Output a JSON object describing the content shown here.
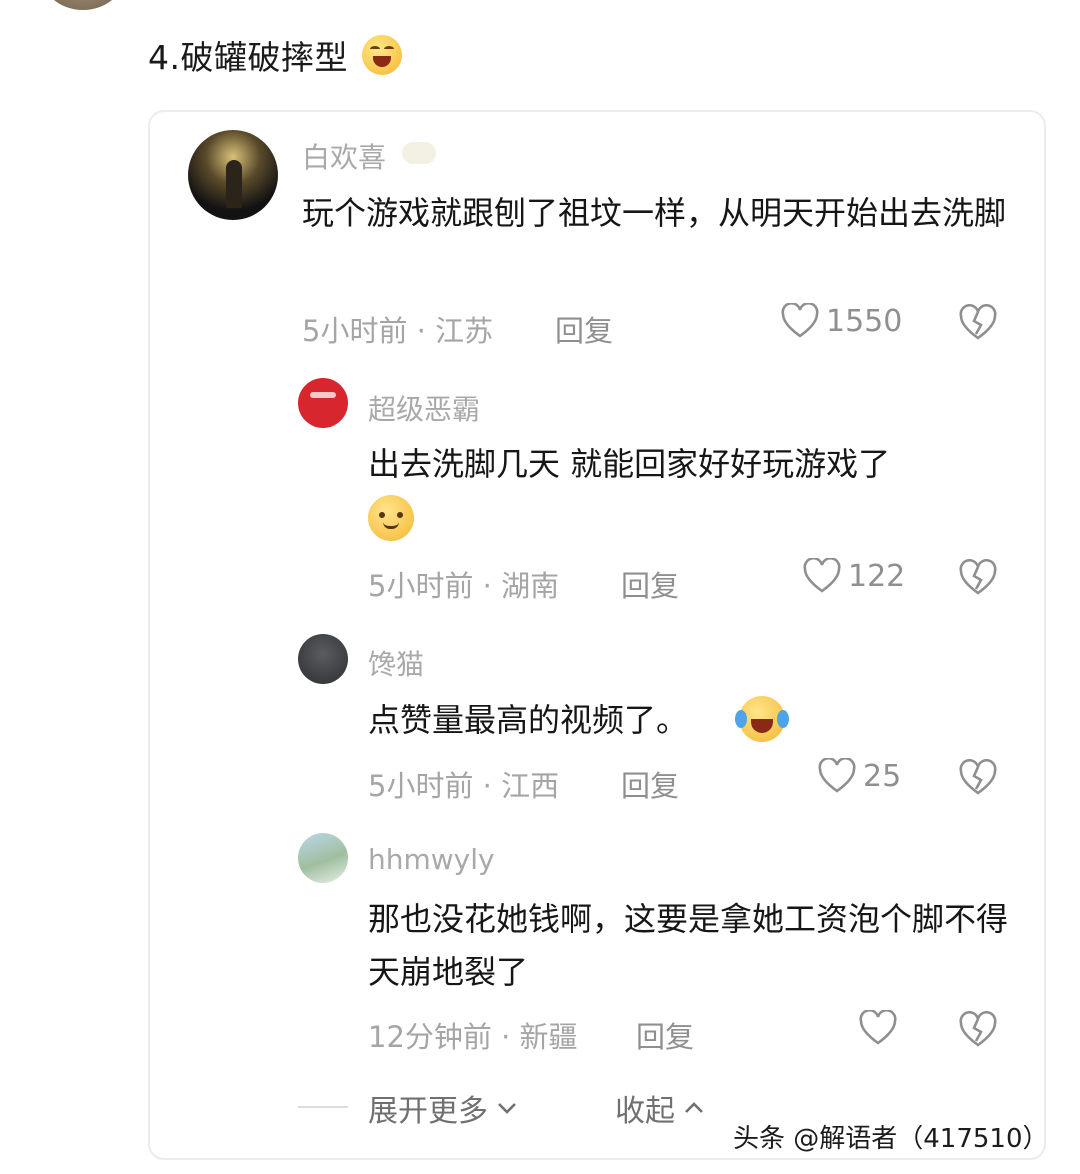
{
  "heading": {
    "text": "4.破罐破摔型"
  },
  "comments": [
    {
      "username": "白欢喜",
      "text": "玩个游戏就跟刨了祖坟一样，从明天开始出去洗脚",
      "meta": "5小时前 · 江苏",
      "reply": "回复",
      "likes": "1550"
    },
    {
      "username": "超级恶霸",
      "text": "出去洗脚几天 就能回家好好玩游戏了",
      "meta": "5小时前 · 湖南",
      "reply": "回复",
      "likes": "122"
    },
    {
      "username": "馋猫",
      "text": "点赞量最高的视频了。",
      "meta": "5小时前 · 江西",
      "reply": "回复",
      "likes": "25"
    },
    {
      "username": "hhmwyly",
      "text": "那也没花她钱啊，这要是拿她工资泡个脚不得天崩地裂了",
      "meta": "12分钟前 · 新疆",
      "reply": "回复",
      "likes": ""
    }
  ],
  "footer": {
    "expand": "展开更多",
    "collapse": "收起"
  },
  "watermark": "头条 @解语者（417510）",
  "colors": {
    "muted": "#a5a5a5",
    "text": "#161616",
    "border": "#ececec"
  }
}
